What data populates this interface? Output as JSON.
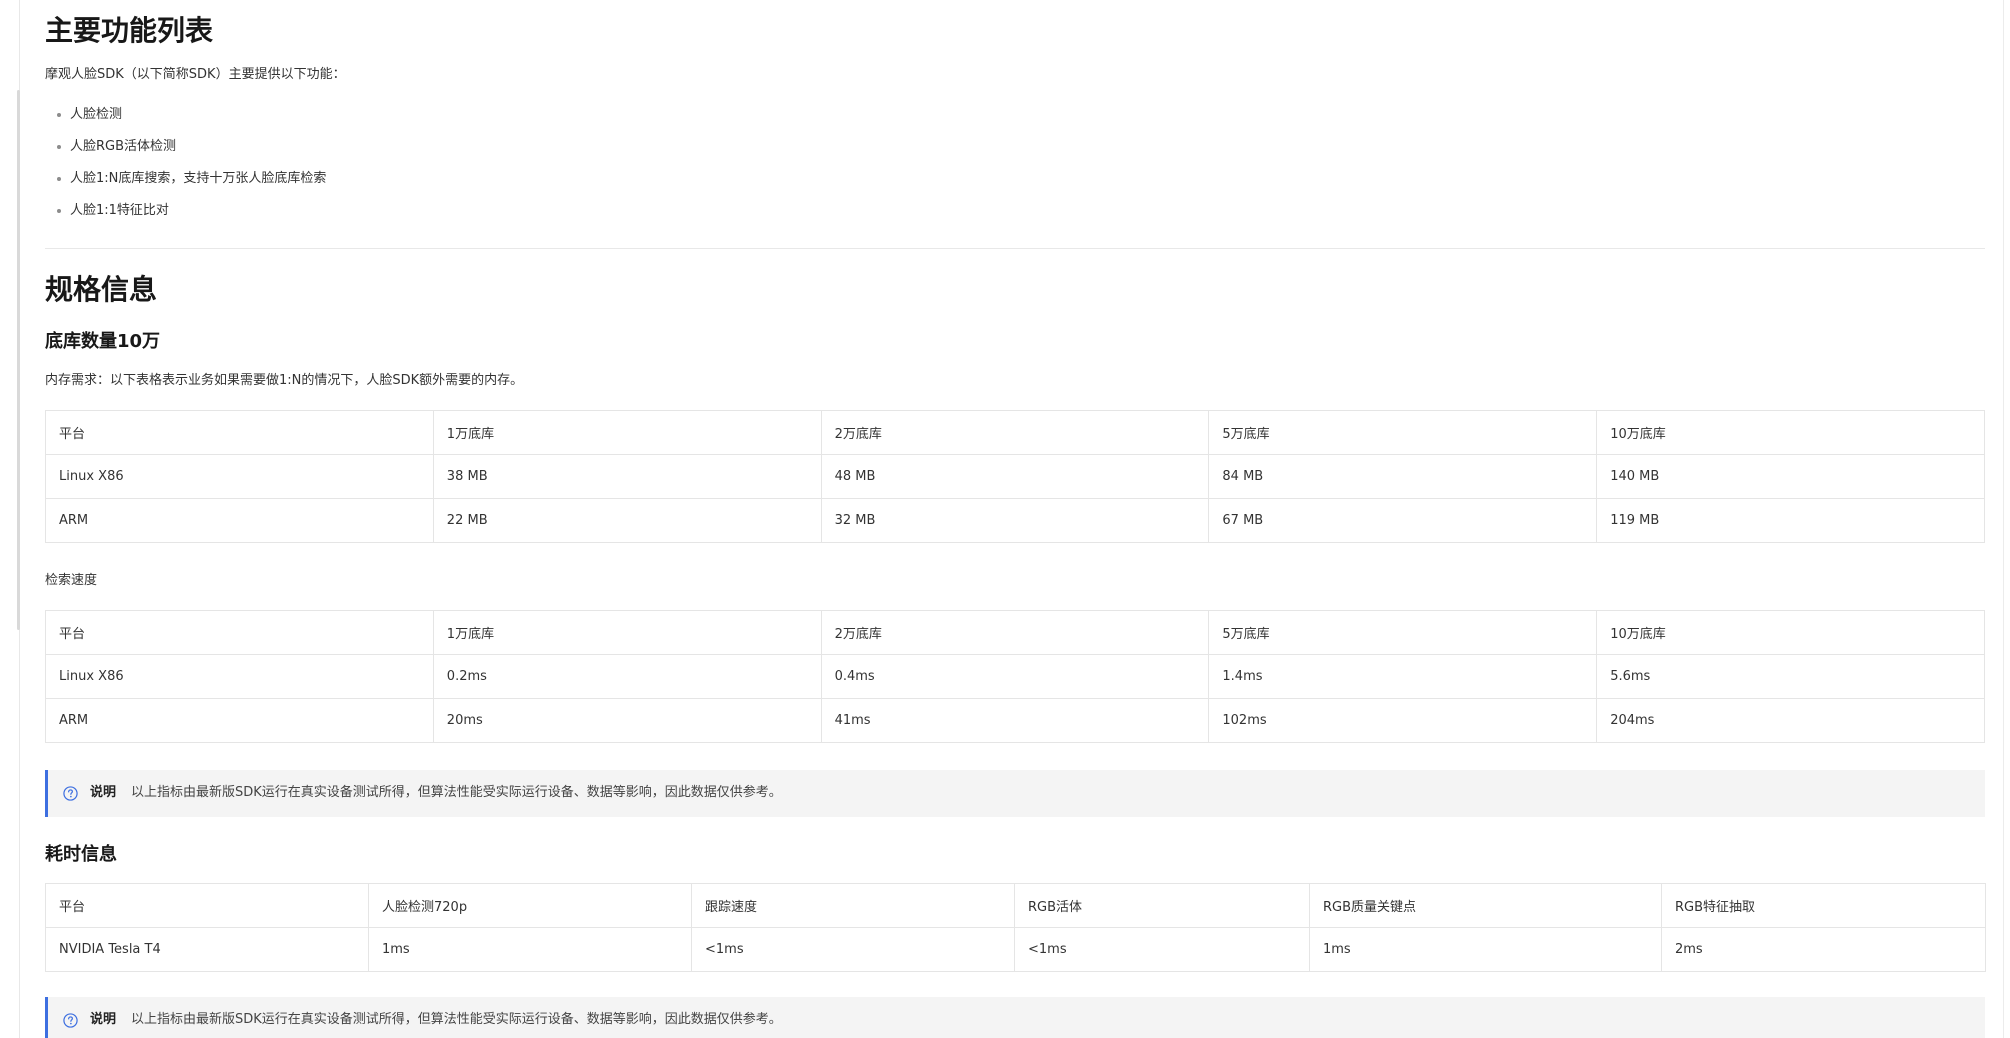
{
  "features": {
    "title": "主要功能列表",
    "intro": "摩观人脸SDK（以下简称SDK）主要提供以下功能：",
    "items": [
      "人脸检测",
      "人脸RGB活体检测",
      "人脸1:N底库搜索，支持十万张人脸底库检索",
      "人脸1:1特征比对"
    ]
  },
  "spec": {
    "title": "规格信息",
    "subtitle": "底库数量10万",
    "memory_desc": "内存需求：以下表格表示业务如果需要做1:N的情况下，人脸SDK额外需要的内存。",
    "memory_table": {
      "headers": [
        "平台",
        "1万底库",
        "2万底库",
        "5万底库",
        "10万底库"
      ],
      "rows": [
        [
          "Linux X86",
          "38 MB",
          "48 MB",
          "84 MB",
          "140 MB"
        ],
        [
          "ARM",
          "22 MB",
          "32 MB",
          "67 MB",
          "119 MB"
        ]
      ]
    },
    "speed_label": "检索速度",
    "speed_table": {
      "headers": [
        "平台",
        "1万底库",
        "2万底库",
        "5万底库",
        "10万底库"
      ],
      "rows": [
        [
          "Linux X86",
          "0.2ms",
          "0.4ms",
          "1.4ms",
          "5.6ms"
        ],
        [
          "ARM",
          "20ms",
          "41ms",
          "102ms",
          "204ms"
        ]
      ]
    },
    "note": {
      "icon": "question-circle-icon",
      "title": "说明",
      "text": "以上指标由最新版SDK运行在真实设备测试所得，但算法性能受实际运行设备、数据等影响，因此数据仅供参考。"
    }
  },
  "timing": {
    "title": "耗时信息",
    "table": {
      "headers": [
        "平台",
        "人脸检测720p",
        "跟踪速度",
        "RGB活体",
        "RGB质量关键点",
        "RGB特征抽取"
      ],
      "rows": [
        [
          "NVIDIA Tesla T4",
          "1ms",
          "<1ms",
          "<1ms",
          "1ms",
          "2ms"
        ]
      ]
    },
    "note": {
      "icon": "question-circle-icon",
      "title": "说明",
      "text": "以上指标由最新版SDK运行在真实设备测试所得，但算法性能受实际运行设备、数据等影响，因此数据仅供参考。"
    }
  },
  "colors": {
    "note_accent": "#3d6fe0",
    "note_background": "#f4f4f4",
    "table_border": "#e5e5e5"
  }
}
